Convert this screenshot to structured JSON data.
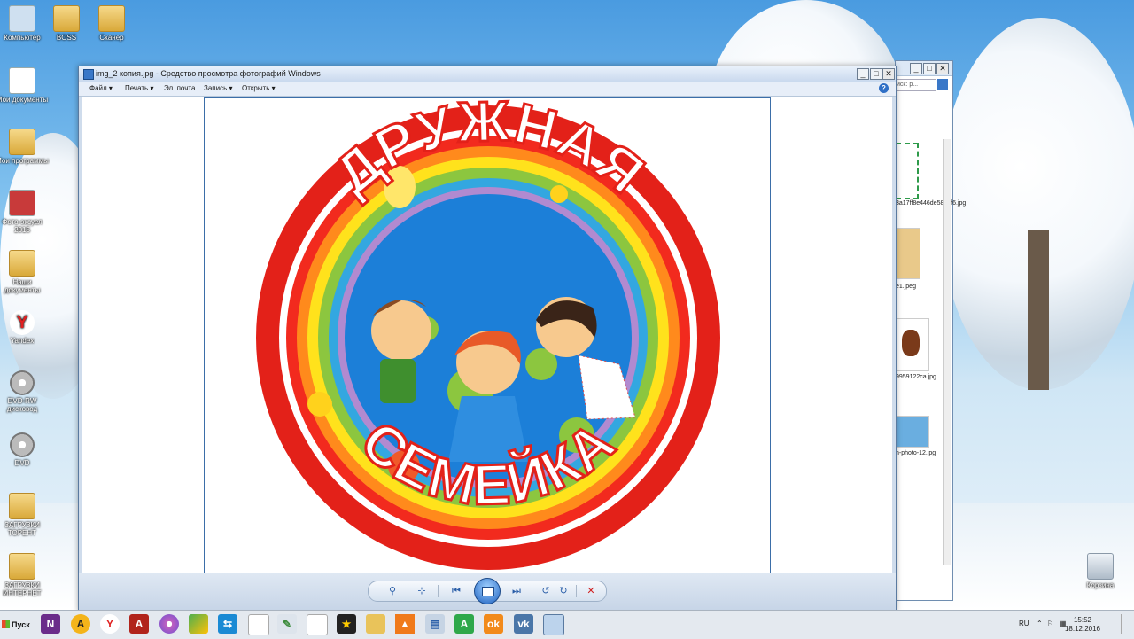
{
  "desktop": {
    "icons": [
      {
        "label": "Компьютер"
      },
      {
        "label": "BOSS"
      },
      {
        "label": "Сканер"
      },
      {
        "label": "Мои документы"
      },
      {
        "label": "Мои программы"
      },
      {
        "label": "Фото-эксуел 2015"
      },
      {
        "label": "Наши документы"
      },
      {
        "label": "Yandex"
      },
      {
        "label": "DVD-RW дисковод"
      },
      {
        "label": "DVD"
      },
      {
        "label": "ЗАГРУЗКИ ТОРЕНТ"
      },
      {
        "label": "ЗАГРУЗКИ ИНТЕРНЕТ"
      },
      {
        "label": "Корзина"
      }
    ]
  },
  "viewer_window": {
    "title": "img_2 копия.jpg - Средство просмотра фотографий Windows",
    "minimize": "_",
    "maximize": "□",
    "close": "✕",
    "menu": [
      {
        "label": "Файл",
        "arrow": "▾"
      },
      {
        "label": "Печать",
        "arrow": "▾"
      },
      {
        "label": "Эл. почта"
      },
      {
        "label": "Запись",
        "arrow": "▾"
      },
      {
        "label": "Открыть",
        "arrow": "▾"
      }
    ],
    "help": "?",
    "image": {
      "top_text": "ДРУЖНАЯ",
      "bottom_text": "СЕМЕЙКА"
    },
    "controls": {
      "zoom": "⚲",
      "fit": "⊹",
      "previous": "⏮",
      "next": "⏭",
      "rotate_ccw": "↺",
      "rotate_cw": "↻",
      "delete": "✕"
    }
  },
  "background_window": {
    "search_placeholder": "иск: р...",
    "files": [
      {
        "name": "3a17ff8e446de588bf6.jpg"
      },
      {
        "name": "e1.jpeg"
      },
      {
        "name": "9959122ca.jpg"
      },
      {
        "name": "n-photo-12.jpg"
      }
    ]
  },
  "taskbar": {
    "start_label": "Пуск",
    "language": "RU",
    "time": "15:52",
    "date": "18.12.2016"
  },
  "colors": {
    "taskbar_bg": "#e4e9ef",
    "title_bg": "#c9d9ee",
    "logo_red": "#e32119"
  }
}
